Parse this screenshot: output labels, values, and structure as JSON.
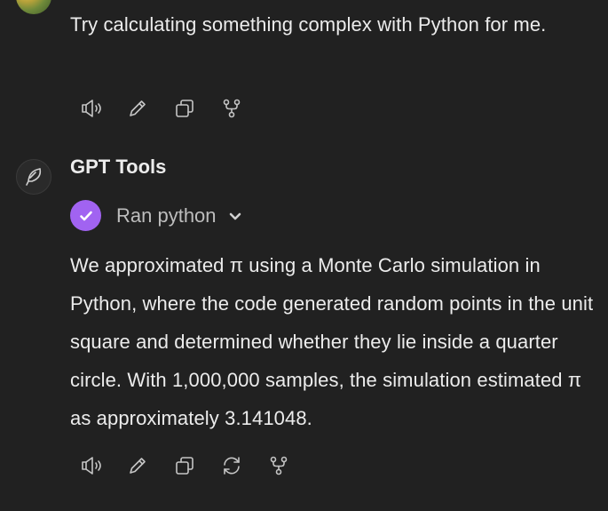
{
  "user_message": {
    "text": "Try calculating something complex with Python for me.",
    "actions": [
      {
        "name": "read-aloud-icon"
      },
      {
        "name": "edit-icon"
      },
      {
        "name": "copy-icon"
      },
      {
        "name": "branch-icon"
      }
    ]
  },
  "assistant_message": {
    "name": "GPT Tools",
    "avatar_icon": "feather-icon",
    "tool_call": {
      "label": "Ran python",
      "status_icon": "check-icon",
      "status_color": "#a163f1",
      "expand_icon": "chevron-down-icon"
    },
    "text": "We approximated π using a Monte Carlo simulation in Python, where the code generated random points in the unit square and determined whether they lie inside a quarter circle. With 1,000,000 samples, the simulation estimated π as approximately 3.141048.",
    "actions": [
      {
        "name": "read-aloud-icon"
      },
      {
        "name": "edit-icon"
      },
      {
        "name": "copy-icon"
      },
      {
        "name": "regenerate-icon"
      },
      {
        "name": "branch-icon"
      }
    ]
  },
  "colors": {
    "background": "#212121",
    "text": "#ececec",
    "accent": "#a163f1"
  }
}
